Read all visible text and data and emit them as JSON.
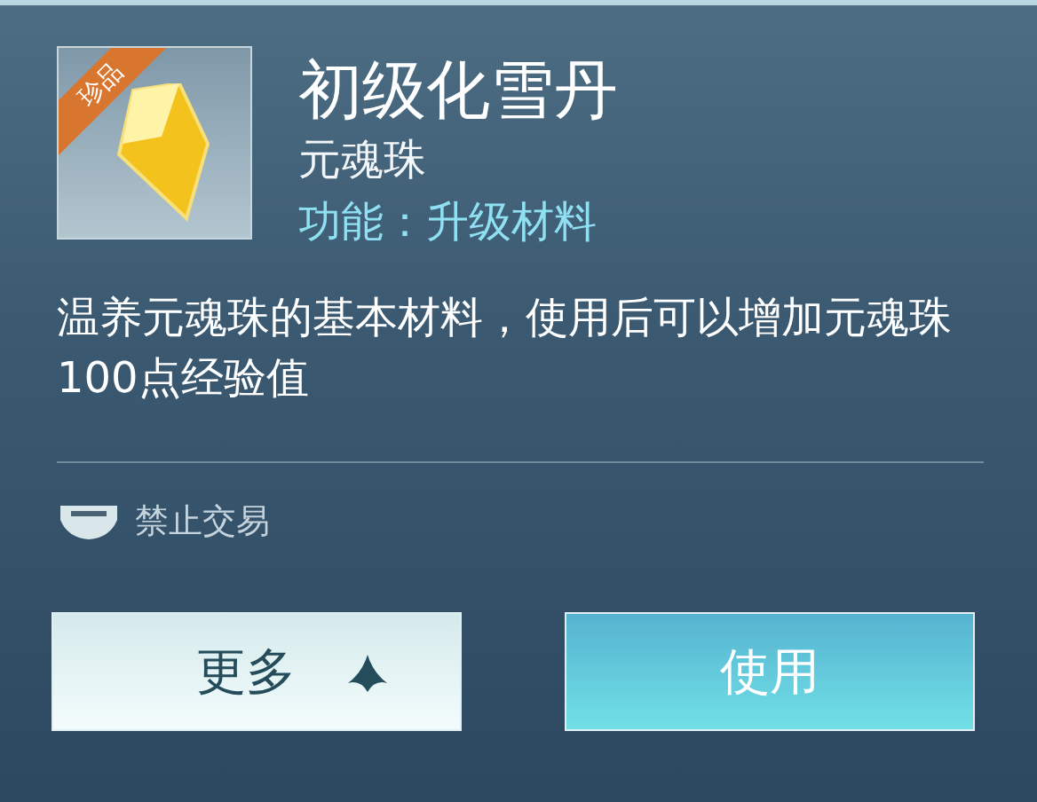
{
  "item": {
    "badge": "珍品",
    "name": "初级化雪丹",
    "category": "元魂珠",
    "function": "功能：升级材料"
  },
  "description": "温养元魂珠的基本材料，使用后可以增加元魂珠100点经验值",
  "trade": {
    "label": "禁止交易"
  },
  "buttons": [
    {
      "label": "更多",
      "kind": "more"
    },
    {
      "label": "使用",
      "kind": "primary"
    }
  ]
}
